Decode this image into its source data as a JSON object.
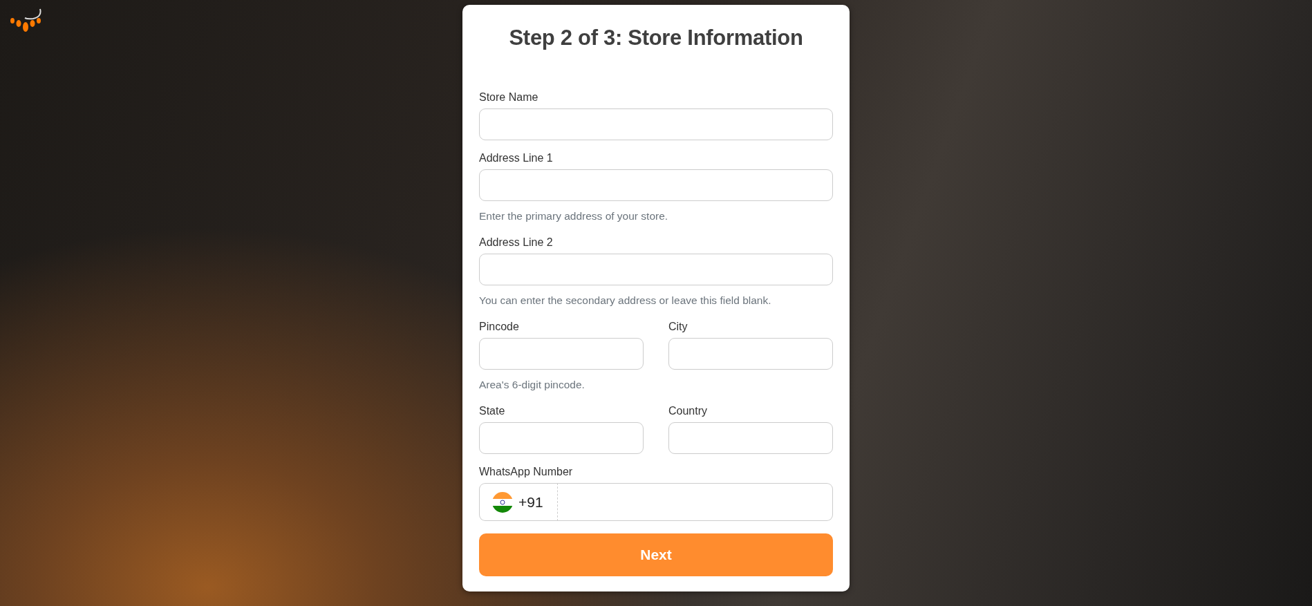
{
  "title": "Step 2 of 3: Store Information",
  "form": [
    [
      {
        "label": "Store Name"
      }
    ],
    [
      {
        "label": "Address Line 1",
        "help": "Enter the primary address of your store."
      }
    ],
    [
      {
        "label": "Address Line 2",
        "help": "You can enter the secondary address or leave this field blank."
      }
    ],
    [
      {
        "label": "Pincode",
        "help": "Area's 6-digit pincode."
      },
      {
        "label": "City"
      }
    ],
    [
      {
        "label": "State"
      },
      {
        "label": "Country"
      }
    ]
  ],
  "phone": {
    "label": "WhatsApp Number",
    "country_code": "+91"
  },
  "submit": "Next"
}
